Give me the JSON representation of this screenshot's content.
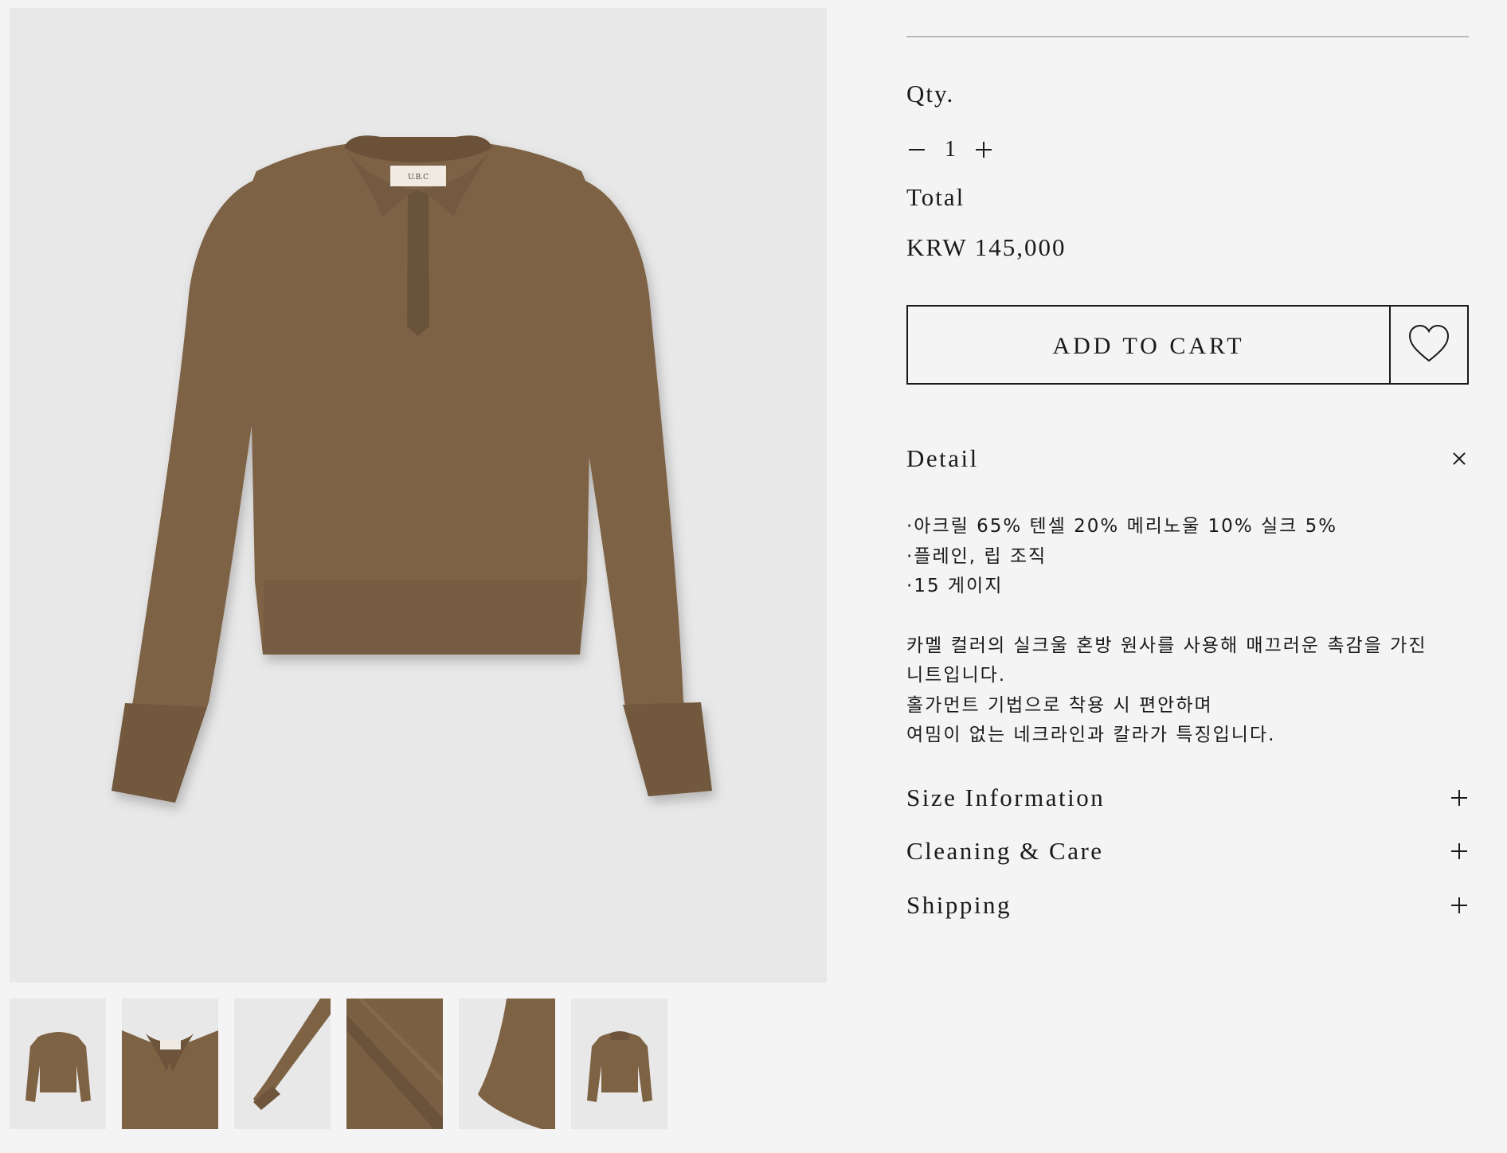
{
  "gallery": {
    "main_image_alt": "",
    "thumbnails": [
      {
        "name": "thumb-front"
      },
      {
        "name": "thumb-collar-detail"
      },
      {
        "name": "thumb-sleeve-detail"
      },
      {
        "name": "thumb-knit-texture"
      },
      {
        "name": "thumb-side-detail"
      },
      {
        "name": "thumb-back"
      }
    ]
  },
  "product": {
    "qty_label": "Qty.",
    "qty_value": "1",
    "total_label": "Total",
    "price": "KRW 145,000",
    "add_to_cart_label": "ADD TO CART"
  },
  "detail": {
    "title": "Detail",
    "lines": [
      "·아크릴 65% 텐셀 20% 메리노울 10% 실크 5%",
      "·플레인, 립 조직",
      "·15 게이지"
    ],
    "description": [
      "카멜 컬러의 실크울 혼방 원사를 사용해 매끄러운 촉감을 가진",
      "니트입니다.",
      "홀가먼트 기법으로 착용 시 편안하며",
      "여밈이 없는 네크라인과 칼라가 특징입니다."
    ]
  },
  "accordions": [
    {
      "title": "Size Information"
    },
    {
      "title": "Cleaning & Care"
    },
    {
      "title": "Shipping"
    }
  ],
  "colors": {
    "background": "#f4f4f4",
    "image_bg": "#e8e8e8",
    "sweater": "#7e6244",
    "sweater_shadow": "#6c533a",
    "text": "#1a1a1a"
  }
}
